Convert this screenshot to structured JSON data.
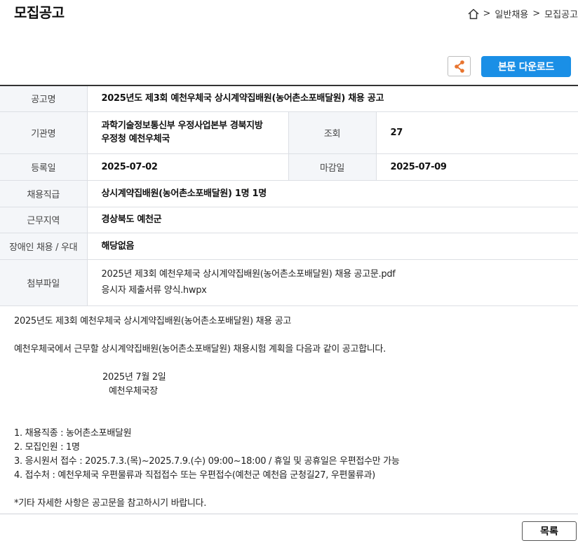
{
  "header": {
    "title": "모집공고",
    "breadcrumb": [
      ">",
      "일반채용",
      ">",
      "모집공고"
    ]
  },
  "actions": {
    "share_icon": "share-icon",
    "download_label": "본문 다운로드",
    "list_label": "목록"
  },
  "info": {
    "title_label": "공고명",
    "title_value": "2025년도 제3회 예천우체국 상시계약집배원(농어촌소포배달원) 채용 공고",
    "org_label": "기관명",
    "org_value_line1": "과학기술정보통신부 우정사업본부 경북지방",
    "org_value_line2": "우정청 예천우체국",
    "views_label": "조회",
    "views_value": "27",
    "reg_label": "등록일",
    "reg_value": "2025-07-02",
    "deadline_label": "마감일",
    "deadline_value": "2025-07-09",
    "job_label": "채용직급",
    "job_value": "상시계약집배원(농어촌소포배달원) 1명 1명",
    "region_label": "근무지역",
    "region_value": "경상북도 예천군",
    "disabled_label": "장애인 채용 / 우대",
    "disabled_value": "해당없음",
    "files_label": "첨부파일",
    "files": [
      "2025년 제3회 예천우체국 상시계약집배원(농어촌소포배달원) 채용 공고문.pdf",
      "응시자 제출서류 양식.hwpx"
    ]
  },
  "body": {
    "line1": "2025년도 제3회 예천우체국 상시계약집배원(농어촌소포배달원) 채용 공고",
    "line2": "예천우체국에서 근무할 상시계약집배원(농어촌소포배달원) 채용시험 계획을 다음과 같이 공고합니다.",
    "date": "2025년 7월 2일",
    "signer": "예천우체국장",
    "item1": "1. 채용직종 : 농어촌소포배달원",
    "item2": "2. 모집인원 : 1명",
    "item3": "3. 응시원서 접수 : 2025.7.3.(목)~2025.7.9.(수) 09:00~18:00 / 휴일 및 공휴일은 우편접수만 가능",
    "item4": "4. 접수처 : 예천우체국 우편물류과 직접접수 또는 우편접수(예천군 예천읍 군청길27, 우편물류과)",
    "note": "*기타 자세한 사항은 공고문을 참고하시기 바랍니다."
  },
  "colors": {
    "accent": "#1a8fe6",
    "share": "#e8742e",
    "header_bg": "#f4f6f9"
  }
}
